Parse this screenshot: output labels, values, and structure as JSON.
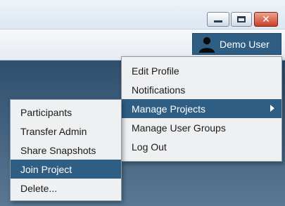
{
  "window": {
    "controls": {
      "minimize_icon": "minimize-icon",
      "maximize_icon": "maximize-icon",
      "close_icon": "close-icon",
      "close_glyph": "✕"
    }
  },
  "header": {
    "user_name": "Demo User",
    "user_icon": "user-icon"
  },
  "user_menu": {
    "items": [
      {
        "label": "Edit Profile"
      },
      {
        "label": "Notifications"
      },
      {
        "label": "Manage Projects",
        "active": true,
        "has_submenu": true
      },
      {
        "label": "Manage User Groups"
      },
      {
        "label": "Log Out"
      }
    ]
  },
  "project_submenu": {
    "items": [
      {
        "label": "Participants"
      },
      {
        "label": "Transfer Admin"
      },
      {
        "label": "Share Snapshots"
      },
      {
        "label": "Join Project",
        "active": true
      },
      {
        "label": "Delete..."
      }
    ]
  },
  "colors": {
    "accent": "#2f5e85",
    "menu_bg": "#eef0f2",
    "background_top": "#2f4f6d",
    "background_bottom": "#5a7894"
  }
}
